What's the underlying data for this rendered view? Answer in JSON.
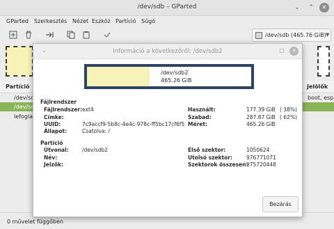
{
  "main": {
    "title": "/dev/sdb – GParted",
    "menu": [
      "GParted",
      "Szerkesztés",
      "Nézet",
      "Eszköz",
      "Partíció",
      "Súgó"
    ],
    "device_selector": "/dev/sdb  (465.76 GiB)",
    "columns": [
      "Partíció",
      "Jelölők"
    ],
    "rows": [
      {
        "partition": "/dev/sd",
        "flags": "boot, esp"
      },
      {
        "partition": "/dev/sd",
        "flags": ""
      },
      {
        "partition": "lefoglal",
        "flags": ""
      }
    ],
    "status": "0 művelet függőben"
  },
  "dialog": {
    "title": "Információ a következőről: /dev/sdb2",
    "bar": {
      "name": "/dev/sdb2",
      "size": "465.26 GiB",
      "used_fraction": 0.38
    },
    "filesystem": {
      "section": "Fájlrendszer",
      "labels": {
        "fs": "Fájlrendszer:",
        "label": "Címke:",
        "uuid": "UUID:",
        "state": "Állapot:",
        "used": "Használt:",
        "free": "Szabad:",
        "size": "Méret:"
      },
      "values": {
        "fs": "ext4",
        "label": "",
        "uuid": "7c9accf9-5b8c-4e4c-978c-ff5bc17cf6f5",
        "state": "Csatolva: /",
        "used": "177.39 GiB",
        "used_pct": "( 38%)",
        "free": "287.87 GiB",
        "free_pct": "( 62%)",
        "size": "465.26 GiB"
      }
    },
    "partition": {
      "section": "Partíció",
      "labels": {
        "path": "Útvonal:",
        "name": "Név:",
        "flags": "Jelzők:",
        "first": "Első szektor:",
        "last": "Utolsó szektor:",
        "total": "Szektorok összesen:"
      },
      "values": {
        "path": "/dev/sdb2",
        "name": "",
        "flags": "",
        "first": "1050624",
        "last": "976771071",
        "total": "975720448"
      }
    },
    "close_label": "Bezárás"
  },
  "colors": {
    "used_fill": "#f7f3b8",
    "partition_border": "#2c4363",
    "selected_row": "#8ab458"
  }
}
